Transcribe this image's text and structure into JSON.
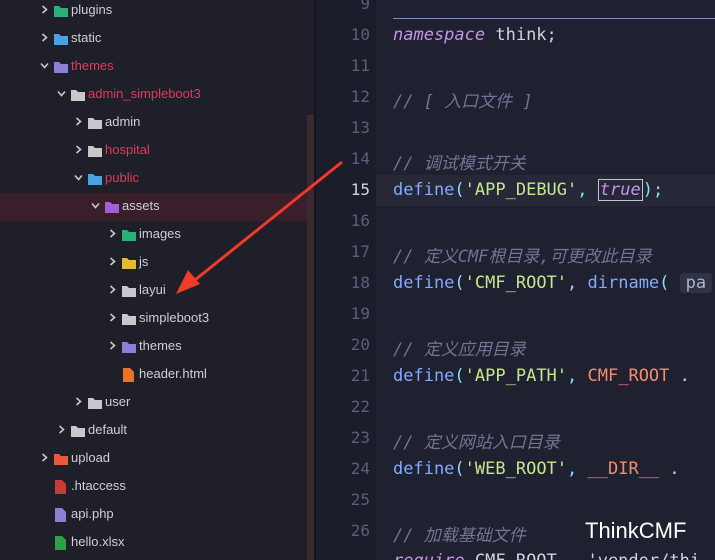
{
  "tree": [
    {
      "label": "plugins",
      "indent": 0,
      "arrow": "right",
      "icon": "plugin-folder-icon",
      "color": "#2bb07a",
      "red": false
    },
    {
      "label": "static",
      "indent": 0,
      "arrow": "right",
      "icon": "static-folder-icon",
      "color": "#4aa3e0",
      "red": false
    },
    {
      "label": "themes",
      "indent": 0,
      "arrow": "down",
      "icon": "themes-folder-icon",
      "color": "#8b7fd8",
      "red": true
    },
    {
      "label": "admin_simpleboot3",
      "indent": 1,
      "arrow": "down",
      "icon": "folder-open-icon",
      "color": "#c8c8c8",
      "red": true
    },
    {
      "label": "admin",
      "indent": 2,
      "arrow": "right",
      "icon": "folder-icon",
      "color": "#c8c8c8",
      "red": false
    },
    {
      "label": "hospital",
      "indent": 2,
      "arrow": "right",
      "icon": "folder-icon",
      "color": "#c8c8c8",
      "red": true
    },
    {
      "label": "public",
      "indent": 2,
      "arrow": "down",
      "icon": "public-folder-icon",
      "color": "#4aa3e0",
      "red": true
    },
    {
      "label": "assets",
      "indent": 3,
      "arrow": "down",
      "icon": "assets-folder-icon",
      "color": "#a060d8",
      "red": false,
      "selected": true
    },
    {
      "label": "images",
      "indent": 4,
      "arrow": "right",
      "icon": "images-folder-icon",
      "color": "#2bb07a",
      "red": false
    },
    {
      "label": "js",
      "indent": 4,
      "arrow": "right",
      "icon": "js-folder-icon",
      "color": "#e8b83a",
      "red": false
    },
    {
      "label": "layui",
      "indent": 4,
      "arrow": "right",
      "icon": "folder-icon",
      "color": "#c8c8c8",
      "red": false
    },
    {
      "label": "simpleboot3",
      "indent": 4,
      "arrow": "right",
      "icon": "folder-icon",
      "color": "#c8c8c8",
      "red": false
    },
    {
      "label": "themes",
      "indent": 4,
      "arrow": "right",
      "icon": "themes-folder-icon",
      "color": "#8b7fd8",
      "red": false
    },
    {
      "label": "header.html",
      "indent": 4,
      "arrow": "none",
      "icon": "html5-file-icon",
      "color": "#e8742a",
      "red": false
    },
    {
      "label": "user",
      "indent": 2,
      "arrow": "right",
      "icon": "folder-icon",
      "color": "#c8c8c8",
      "red": false
    },
    {
      "label": "default",
      "indent": 1,
      "arrow": "right",
      "icon": "folder-icon",
      "color": "#c8c8c8",
      "red": false
    },
    {
      "label": "upload",
      "indent": 0,
      "arrow": "right",
      "icon": "upload-folder-icon",
      "color": "#e85a3a",
      "red": false
    },
    {
      "label": ".htaccess",
      "indent": 0,
      "arrow": "none",
      "icon": "htaccess-file-icon",
      "color": "#c83a3a",
      "red": false
    },
    {
      "label": "api.php",
      "indent": 0,
      "arrow": "none",
      "icon": "php-file-icon",
      "color": "#8b7fd8",
      "red": false
    },
    {
      "label": "hello.xlsx",
      "indent": 0,
      "arrow": "none",
      "icon": "excel-file-icon",
      "color": "#2ea04a",
      "red": false
    }
  ],
  "gutter": [
    "9",
    "10",
    "11",
    "12",
    "13",
    "14",
    "15",
    "16",
    "17",
    "18",
    "19",
    "20",
    "21",
    "22",
    "23",
    "24",
    "25",
    "26"
  ],
  "active_line": "15",
  "code": {
    "l10_kw": "namespace",
    "l10_rest": " think;",
    "l12": "// [ 入口文件 ]",
    "l14": "// 调试模式开关",
    "l15_fn": "define",
    "l15_p1": "(",
    "l15_str": "'APP_DEBUG'",
    "l15_p2": ", ",
    "l15_bool": "true",
    "l15_p3": ");",
    "l17": "// 定义CMF根目录,可更改此目录",
    "l18_fn": "define",
    "l18_p1": "(",
    "l18_str": "'CMF_ROOT'",
    "l18_p2": ", ",
    "l18_fn2": "dirname",
    "l18_p3": "( ",
    "l18_hint": "pa",
    "l20": "// 定义应用目录",
    "l21_fn": "define",
    "l21_p1": "(",
    "l21_str": "'APP_PATH'",
    "l21_p2": ", ",
    "l21_cons": "CMF_ROOT",
    "l21_p3": " .",
    "l23": "// 定义网站入口目录",
    "l24_fn": "define",
    "l24_p1": "(",
    "l24_str": "'WEB_ROOT'",
    "l24_p2": ", ",
    "l24_cons": "__DIR__",
    "l24_p3": " .",
    "l26": "// 加载基础文件",
    "l27_fn": "require",
    "l27_rest": " CMF_ROOT . 'vendor/thi"
  },
  "watermark": "ThinkCMF",
  "colors": {
    "arrow": "#f03a2a",
    "accent_red": "#e8375e"
  }
}
